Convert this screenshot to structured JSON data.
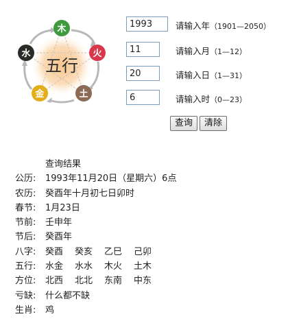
{
  "emblem": {
    "title": "五行",
    "elements": {
      "wood": {
        "char": "木",
        "color": "#3e9a3c"
      },
      "fire": {
        "char": "火",
        "color": "#d8384a"
      },
      "earth": {
        "char": "土",
        "color": "#8b6a56"
      },
      "metal": {
        "char": "金",
        "color": "#e3ad1b"
      },
      "water": {
        "char": "水",
        "color": "#2a2a26"
      }
    }
  },
  "form": {
    "year": {
      "value": "1993",
      "label": "请输入年",
      "range": "（1901—2050）"
    },
    "month": {
      "value": "11",
      "label": "请输入月",
      "range": "（1—12）"
    },
    "day": {
      "value": "20",
      "label": "请输入日",
      "range": "（1—31）"
    },
    "hour": {
      "value": "6",
      "label": "请输入时",
      "range": "（0—23）"
    },
    "query_label": "查询",
    "clear_label": "清除"
  },
  "results": {
    "heading": "查询结果",
    "gregorian": {
      "label": "公历:",
      "value": "1993年11月20日（星期六）6点"
    },
    "lunar": {
      "label": "农历:",
      "value": "癸酉年十月初七日卯时"
    },
    "spring_festival": {
      "label": "春节:",
      "value": "1月23日"
    },
    "prev_festival": {
      "label": "节前:",
      "value": "壬申年"
    },
    "next_festival": {
      "label": "节后:",
      "value": "癸酉年"
    },
    "bazi": {
      "label": "八字:",
      "values": [
        "癸酉",
        "癸亥",
        "乙巳",
        "己卯"
      ]
    },
    "wuxing": {
      "label": "五行:",
      "values": [
        "水金",
        "水水",
        "木火",
        "土木"
      ]
    },
    "direction": {
      "label": "方位:",
      "values": [
        "北西",
        "北北",
        "东南",
        "中东"
      ]
    },
    "lacking": {
      "label": "亏缺:",
      "value": "什么都不缺"
    },
    "zodiac": {
      "label": "生肖:",
      "value": "鸡"
    }
  }
}
